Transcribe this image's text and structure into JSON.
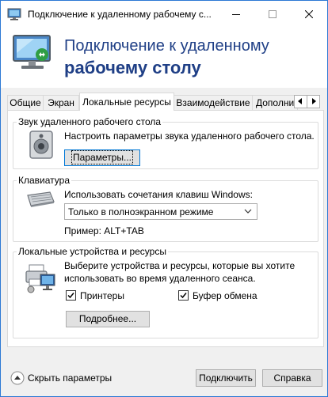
{
  "window": {
    "title": "Подключение к удаленному рабочему с...",
    "controls": [
      "minimize-icon",
      "maximize-icon",
      "close-icon"
    ]
  },
  "header": {
    "title_line1": "Подключение к удаленному",
    "title_line2": "рабочему столу"
  },
  "tabs": [
    {
      "label": "Общие"
    },
    {
      "label": "Экран"
    },
    {
      "label": "Локальные ресурсы",
      "active": true
    },
    {
      "label": "Взаимодействие"
    },
    {
      "label": "Дополнит"
    }
  ],
  "sound": {
    "legend": "Звук удаленного рабочего стола",
    "description": "Настроить параметры звука удаленного рабочего стола.",
    "button": "Параметры..."
  },
  "keyboard": {
    "legend": "Клавиатура",
    "description": "Использовать сочетания клавиш Windows:",
    "select_value": "Только в полноэкранном режиме",
    "example": "Пример: ALT+TAB"
  },
  "local_devices": {
    "legend": "Локальные устройства и ресурсы",
    "description_line1": "Выберите устройства и ресурсы, которые вы хотите",
    "description_line2": "использовать во время удаленного сеанса.",
    "printers_label": "Принтеры",
    "printers_checked": true,
    "clipboard_label": "Буфер обмена",
    "clipboard_checked": true,
    "more_button": "Подробнее..."
  },
  "footer": {
    "hide_options": "Скрыть параметры",
    "connect": "Подключить",
    "help": "Справка"
  },
  "colors": {
    "window_border": "#2b78d4",
    "header_title": "#1f3f86",
    "focus_border": "#0078d7"
  }
}
